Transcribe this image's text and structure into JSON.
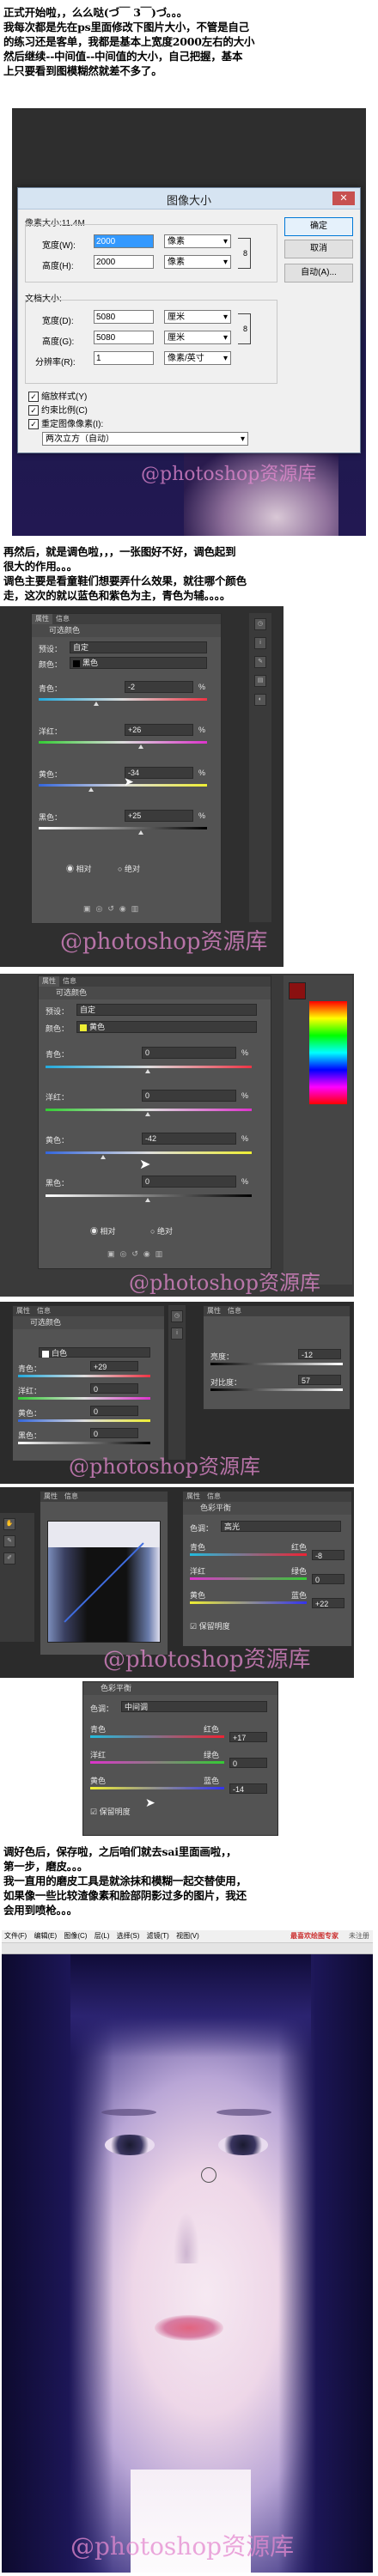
{
  "intro": {
    "lines": [
      "正式开始啦，，么么哒(づ￣ 3￣)づ。。。",
      "我每次都是先在ps里面修改下图片大小，不管是自己",
      "的练习还是客单，我都是基本上宽度2000左右的大小",
      "然后继续--中间值--中间值的大小，自己把握，基本",
      "上只要看到图模糊然就差不多了。"
    ]
  },
  "image_size_dialog": {
    "title": "图像大小",
    "pixel_dims_label": "像素大小:11.4M",
    "width_label": "宽度(W):",
    "width_value": "2000",
    "height_label": "高度(H):",
    "height_value": "2000",
    "pixel_unit": "像素",
    "doc_size_label": "文档大小:",
    "doc_width_label": "宽度(D):",
    "doc_width_value": "5080",
    "doc_height_label": "高度(G):",
    "doc_height_value": "5080",
    "resolution_label": "分辨率(R):",
    "resolution_value": "1",
    "cm_unit": "厘米",
    "res_unit": "像素/英寸",
    "ok": "确定",
    "cancel": "取消",
    "auto": "自动(A)...",
    "scale_styles": "缩放样式(Y)",
    "constrain": "约束比例(C)",
    "resample": "重定图像像素(I):",
    "method": "两次立方（自动）"
  },
  "para2": {
    "lines": [
      "再然后，就是调色啦，，，一张图好不好，调色起到",
      "很大的作用。。。",
      "调色主要是看童鞋们想要弄什么效果，就往哪个颜色",
      "走，这次的就以蓝色和紫色为主，青色为辅。。。。"
    ]
  },
  "sel1": {
    "tab1": "属性",
    "tab2": "信息",
    "header": "可选颜色",
    "preset_label": "预设：",
    "preset_value": "自定",
    "colors_label": "颜色：",
    "colors_value": "黑色",
    "rows": [
      {
        "label": "青色：",
        "value": "-2",
        "pct": "%"
      },
      {
        "label": "洋红：",
        "value": "+26",
        "pct": "%"
      },
      {
        "label": "黄色：",
        "value": "-34",
        "pct": "%"
      },
      {
        "label": "黑色：",
        "value": "+25",
        "pct": "%"
      }
    ],
    "relative": "相对",
    "absolute": "绝对"
  },
  "sel2": {
    "tab1": "属性",
    "tab2": "信息",
    "header": "可选颜色",
    "preset_label": "预设：",
    "preset_value": "自定",
    "colors_label": "颜色：",
    "colors_value": "黄色",
    "rows": [
      {
        "label": "青色：",
        "value": "0",
        "pct": "%"
      },
      {
        "label": "洋红：",
        "value": "0",
        "pct": "%"
      },
      {
        "label": "黄色：",
        "value": "-42",
        "pct": "%"
      },
      {
        "label": "黑色：",
        "value": "0",
        "pct": "%"
      }
    ],
    "relative": "相对",
    "absolute": "绝对"
  },
  "sel3": {
    "header": "可选颜色",
    "colors_value": "白色",
    "rows": [
      {
        "label": "青色：",
        "value": "+29",
        "pct": "%"
      },
      {
        "label": "洋红：",
        "value": "0",
        "pct": "%"
      },
      {
        "label": "黄色：",
        "value": "0",
        "pct": "%"
      },
      {
        "label": "黑色：",
        "value": "0",
        "pct": "%"
      }
    ],
    "side_rows": [
      {
        "label": "亮度：",
        "value": "-12"
      },
      {
        "label": "对比度：",
        "value": "57"
      }
    ]
  },
  "balance1": {
    "header": "色彩平衡",
    "tone_label": "色调：",
    "tone_value": "高光",
    "cyan": "青色",
    "red": "红色",
    "magenta": "洋红",
    "green": "绿色",
    "yellow": "黄色",
    "blue": "蓝色",
    "values": [
      "-8",
      "0",
      "+22"
    ],
    "preserve": "保留明度"
  },
  "balance2": {
    "header": "色彩平衡",
    "tone_label": "色调：",
    "tone_value": "中间调",
    "cyan": "青色",
    "red": "红色",
    "magenta": "洋红",
    "green": "绿色",
    "yellow": "黄色",
    "blue": "蓝色",
    "values": [
      "+17",
      "0",
      "-14"
    ],
    "preserve": "保留明度"
  },
  "para3": {
    "lines": [
      "调好色后，保存啦，之后咱们就去sai里面画啦，，",
      "第一步，磨皮。。。",
      "我一直用的磨皮工具是就涂抹和模糊一起交替使用，",
      "如果像一些比较渣像素和脸部阴影过多的图片，我还",
      "会用到喷枪。。。"
    ]
  },
  "sai": {
    "menu": [
      "文件(F)",
      "编辑(E)",
      "图像(C)",
      "层(L)",
      "选择(S)",
      "滤镜(T)",
      "视图(V)"
    ],
    "brand": "最喜欢绘图专家",
    "version": "未注册"
  },
  "watermark": "@photoshop资源库",
  "colors": {
    "ps_panel": "#535353",
    "ps_dark": "#3f3f3f",
    "dialog_title": "#d6e4f2",
    "purple_bg": "#20174f",
    "watermark": "#e58ad0"
  }
}
